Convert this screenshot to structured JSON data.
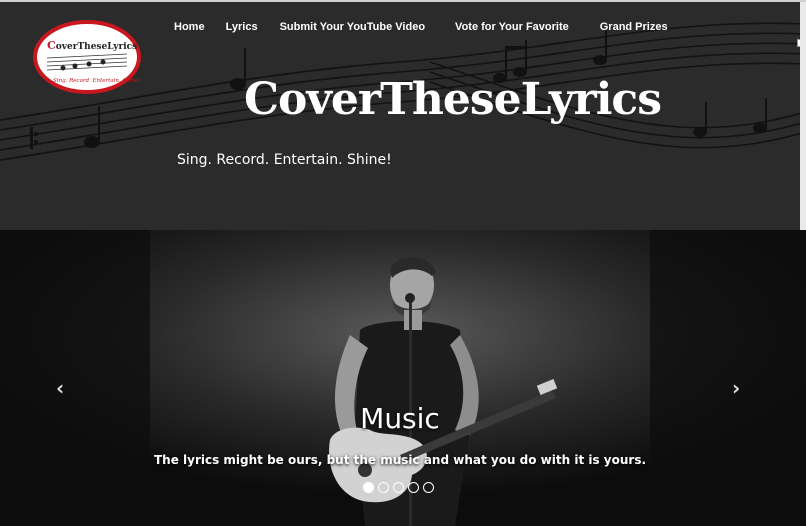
{
  "nav": {
    "items": [
      "Home",
      "Lyrics",
      "Submit Your YouTube Video",
      "Vote for Your Favorite",
      "Grand Prizes"
    ]
  },
  "logo": {
    "text": "CoverTheseLyrics",
    "tagline": "Sing. Record. Entertain. Shine!"
  },
  "header": {
    "title": "CoverTheseLyrics",
    "tagline": "Sing. Record. Entertain. Shine!"
  },
  "slider": {
    "slide_title": "Music",
    "slide_text": "The lyrics might be ours, but the music and what you do with it is yours.",
    "prev_arrow": "‹",
    "next_arrow": "›",
    "slide_count": 5,
    "active_slide": 1
  },
  "colors": {
    "header_bg": "#2b2b2b",
    "logo_red": "#c8171e",
    "text": "#ffffff"
  }
}
